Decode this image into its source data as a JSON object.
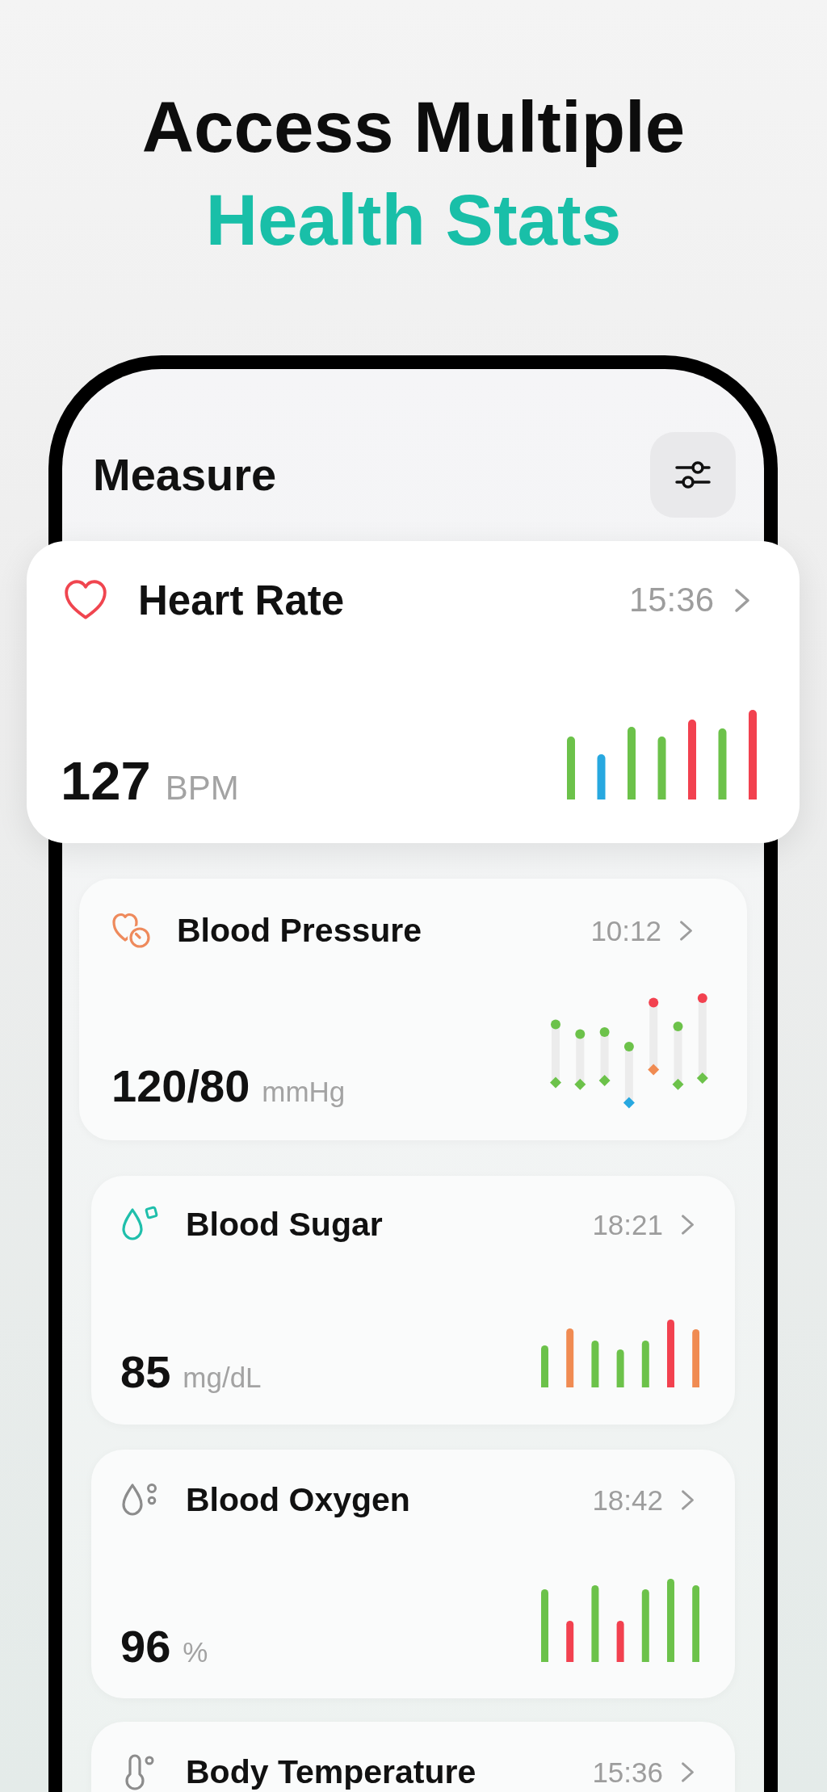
{
  "headline": {
    "line_1": "Access Multiple",
    "line_2": "Health Stats"
  },
  "screen": {
    "title": "Measure"
  },
  "cards": [
    {
      "kind": "bars",
      "title": "Heart Rate",
      "time": "15:36",
      "value": "127",
      "unit": "BPM",
      "color": "#f0454f",
      "selected": true
    },
    {
      "kind": "range",
      "title": "Blood Pressure",
      "time": "10:12",
      "value": "120/80",
      "unit": "mmHg",
      "color": "#ee8a5c",
      "selected": false
    },
    {
      "kind": "bars",
      "title": "Blood Sugar",
      "time": "18:21",
      "value": "85",
      "unit": "mg/dL",
      "color": "#1fbfab",
      "selected": false
    },
    {
      "kind": "bars",
      "title": "Blood Oxygen",
      "time": "18:42",
      "value": "96",
      "unit": "%",
      "color": "#8c8c8c",
      "selected": false
    },
    {
      "kind": "header",
      "title": "Body Temperature",
      "time": "15:36",
      "color": "#8c8c8c",
      "selected": false
    }
  ]
}
